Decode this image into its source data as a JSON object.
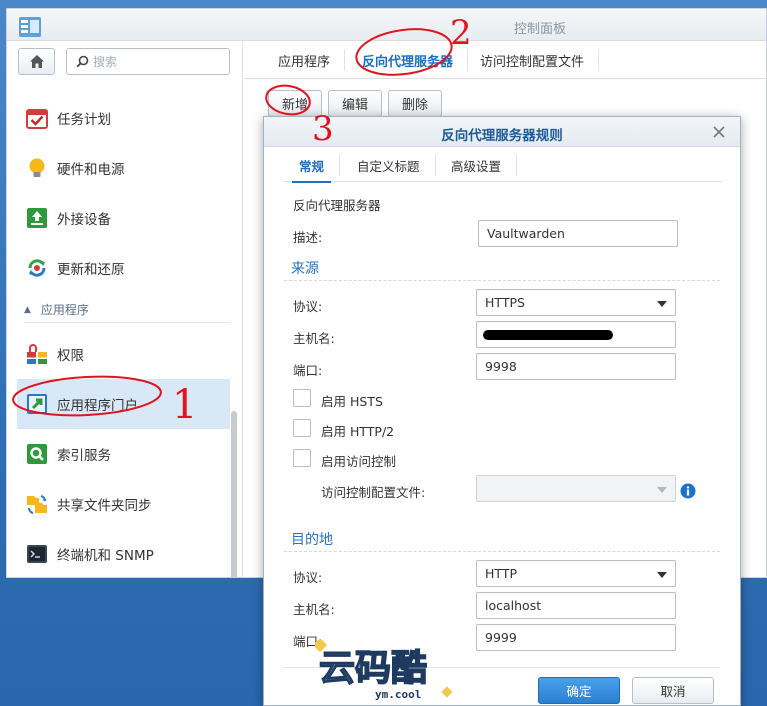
{
  "window": {
    "title": "控制面板",
    "search_placeholder": "搜索"
  },
  "sidebar": {
    "items": [
      {
        "label": "任务计划",
        "icon": "calendar-check-icon"
      },
      {
        "label": "硬件和电源",
        "icon": "lightbulb-icon"
      },
      {
        "label": "外接设备",
        "icon": "external-device-icon"
      },
      {
        "label": "更新和还原",
        "icon": "update-restore-icon"
      }
    ],
    "section": "应用程序",
    "app_items": [
      {
        "label": "权限",
        "icon": "privileges-icon"
      },
      {
        "label": "应用程序门户",
        "icon": "app-portal-icon",
        "active": true
      },
      {
        "label": "索引服务",
        "icon": "index-search-icon"
      },
      {
        "label": "共享文件夹同步",
        "icon": "folder-sync-icon"
      },
      {
        "label": "终端机和 SNMP",
        "icon": "terminal-icon"
      }
    ]
  },
  "tabs": [
    "应用程序",
    "反向代理服务器",
    "访问控制配置文件"
  ],
  "toolbar": {
    "create": "新增",
    "edit": "编辑",
    "delete": "删除"
  },
  "modal": {
    "title": "反向代理服务器规则",
    "tabs": [
      "常规",
      "自定义标题",
      "高级设置"
    ],
    "header_label": "反向代理服务器",
    "description_label": "描述:",
    "description_value": "Vaultwarden",
    "source": {
      "title": "来源",
      "protocol_label": "协议:",
      "protocol_value": "HTTPS",
      "hostname_label": "主机名:",
      "port_label": "端口:",
      "port_value": "9998",
      "hsts_label": "启用 HSTS",
      "http2_label": "启用 HTTP/2",
      "access_control_label": "启用访问控制",
      "access_profile_label": "访问控制配置文件:"
    },
    "destination": {
      "title": "目的地",
      "protocol_label": "协议:",
      "protocol_value": "HTTP",
      "hostname_label": "主机名:",
      "hostname_value": "localhost",
      "port_label": "端口:",
      "port_value": "9999"
    },
    "ok": "确定",
    "cancel": "取消"
  },
  "watermark": {
    "text": "云码酷",
    "sub": "ym.cool"
  },
  "annotations": [
    "1",
    "2",
    "3"
  ],
  "colors": {
    "accent": "#1d6fc2",
    "annotation": "#e0141e",
    "active_bg": "#d9e8f6"
  }
}
